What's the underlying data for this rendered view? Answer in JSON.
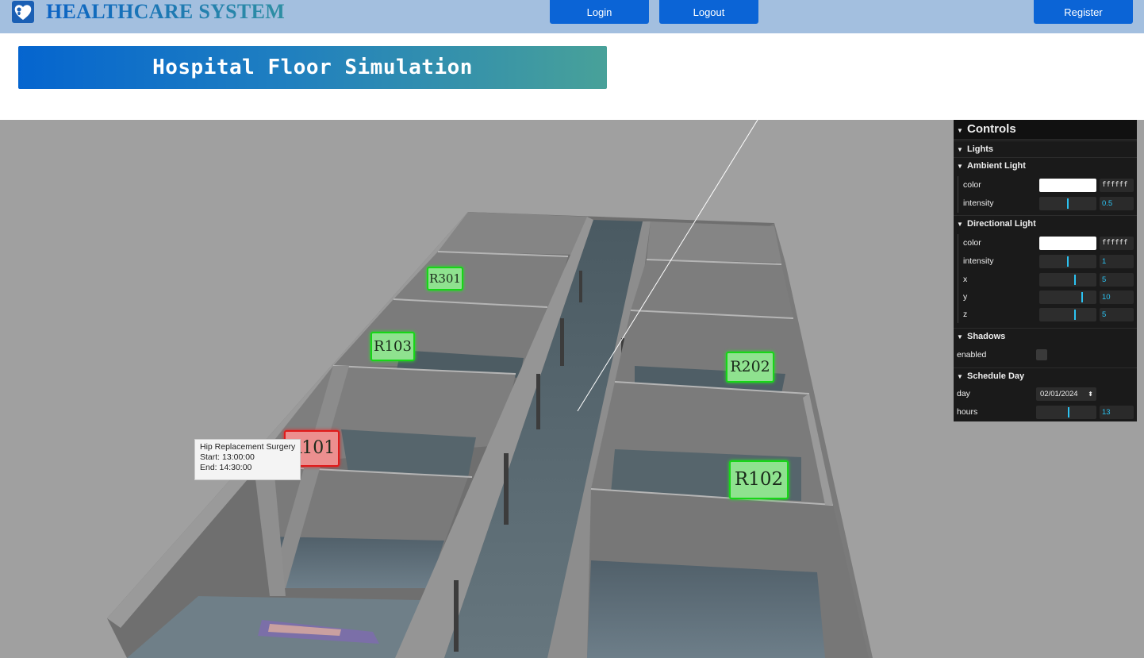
{
  "header": {
    "brand": "HEALTHCARE SYSTEM",
    "logo_icon": "heart-logo-icon",
    "login_label": "Login",
    "logout_label": "Logout",
    "register_label": "Register"
  },
  "banner": {
    "title": "Hospital Floor Simulation"
  },
  "scene": {
    "rooms": [
      {
        "id": "r301",
        "label": "R301",
        "status": "available"
      },
      {
        "id": "r103",
        "label": "R103",
        "status": "available"
      },
      {
        "id": "r202",
        "label": "R202",
        "status": "available"
      },
      {
        "id": "r101",
        "label": "R101",
        "status": "occupied"
      },
      {
        "id": "r102",
        "label": "R102",
        "status": "available"
      }
    ],
    "tooltip": {
      "title": "Hip Replacement Surgery",
      "start": "Start: 13:00:00",
      "end": "End: 14:30:00"
    },
    "colors": {
      "available": "#8fe28f",
      "occupied": "#ec8f8f"
    }
  },
  "controls": {
    "title": "Controls",
    "lights_folder": "Lights",
    "ambient": {
      "folder": "Ambient Light",
      "color_label": "color",
      "color_value": "ffffff",
      "intensity_label": "intensity",
      "intensity_value": "0.5"
    },
    "directional": {
      "folder": "Directional Light",
      "color_label": "color",
      "color_value": "ffffff",
      "intensity_label": "intensity",
      "intensity_value": "1",
      "x_label": "x",
      "x_value": "5",
      "y_label": "y",
      "y_value": "10",
      "z_label": "z",
      "z_value": "5"
    },
    "shadows": {
      "folder": "Shadows",
      "enabled_label": "enabled",
      "enabled": false
    },
    "schedule": {
      "folder": "Schedule Day",
      "day_label": "day",
      "day_value": "02/01/2024",
      "hours_label": "hours",
      "hours_value": "13"
    }
  }
}
